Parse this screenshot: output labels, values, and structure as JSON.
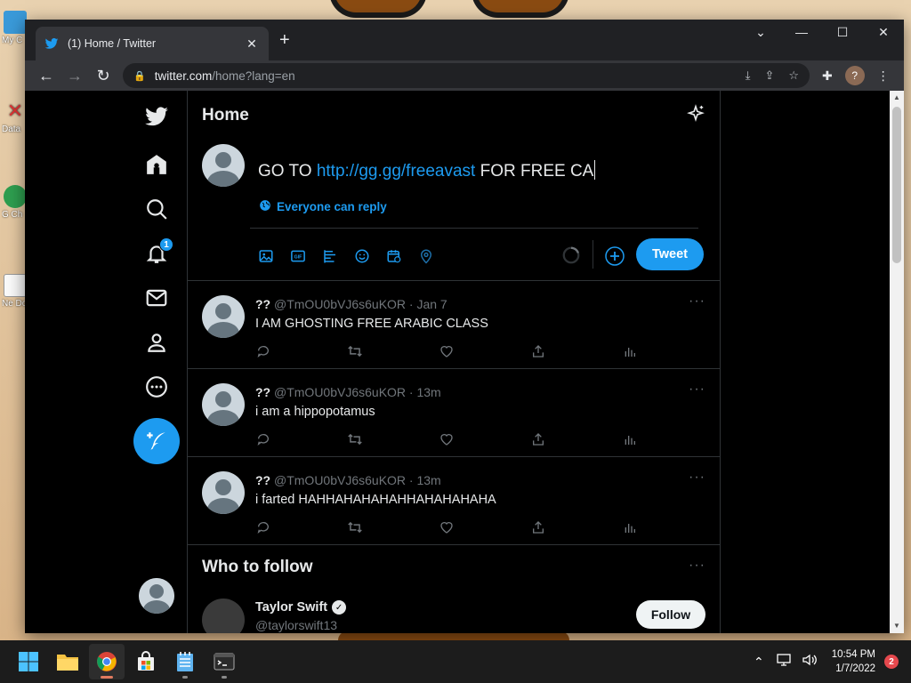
{
  "desktop": {
    "icons": [
      {
        "label": "My C"
      },
      {
        "label": "Data"
      },
      {
        "label": "G Ch"
      },
      {
        "label": "Ne Doc"
      }
    ]
  },
  "browser": {
    "tab_title": "(1) Home / Twitter",
    "url_host": "twitter.com",
    "url_path": "/home?lang=en",
    "profile_initial": "?"
  },
  "twitter": {
    "header_title": "Home",
    "notification_count": "1",
    "compose": {
      "text_before": "GO TO ",
      "text_link": "http://gg.gg/freeavast",
      "text_after": " FOR FREE CA",
      "reply_setting": "Everyone can reply",
      "tweet_label": "Tweet"
    },
    "tweets": [
      {
        "display_name": "??",
        "meta": "@TmOU0bVJ6s6uKOR · Jan 7",
        "text": "I AM GHOSTING FREE ARABIC CLASS"
      },
      {
        "display_name": "??",
        "meta": "@TmOU0bVJ6s6uKOR · 13m",
        "text": "i am a hippopotamus"
      },
      {
        "display_name": "??",
        "meta": "@TmOU0bVJ6s6uKOR · 13m",
        "text": "i farted HAHHAHAHAHAHHAHAHAHAHA"
      }
    ],
    "who_to_follow": {
      "title": "Who to follow",
      "items": [
        {
          "name": "Taylor Swift",
          "handle": "@taylorswift13",
          "button": "Follow"
        }
      ]
    }
  },
  "taskbar": {
    "time": "10:54 PM",
    "date": "1/7/2022",
    "notification_count": "2"
  },
  "colors": {
    "accent": "#1d9bf0",
    "background": "#000000",
    "divider": "#2f3336"
  }
}
